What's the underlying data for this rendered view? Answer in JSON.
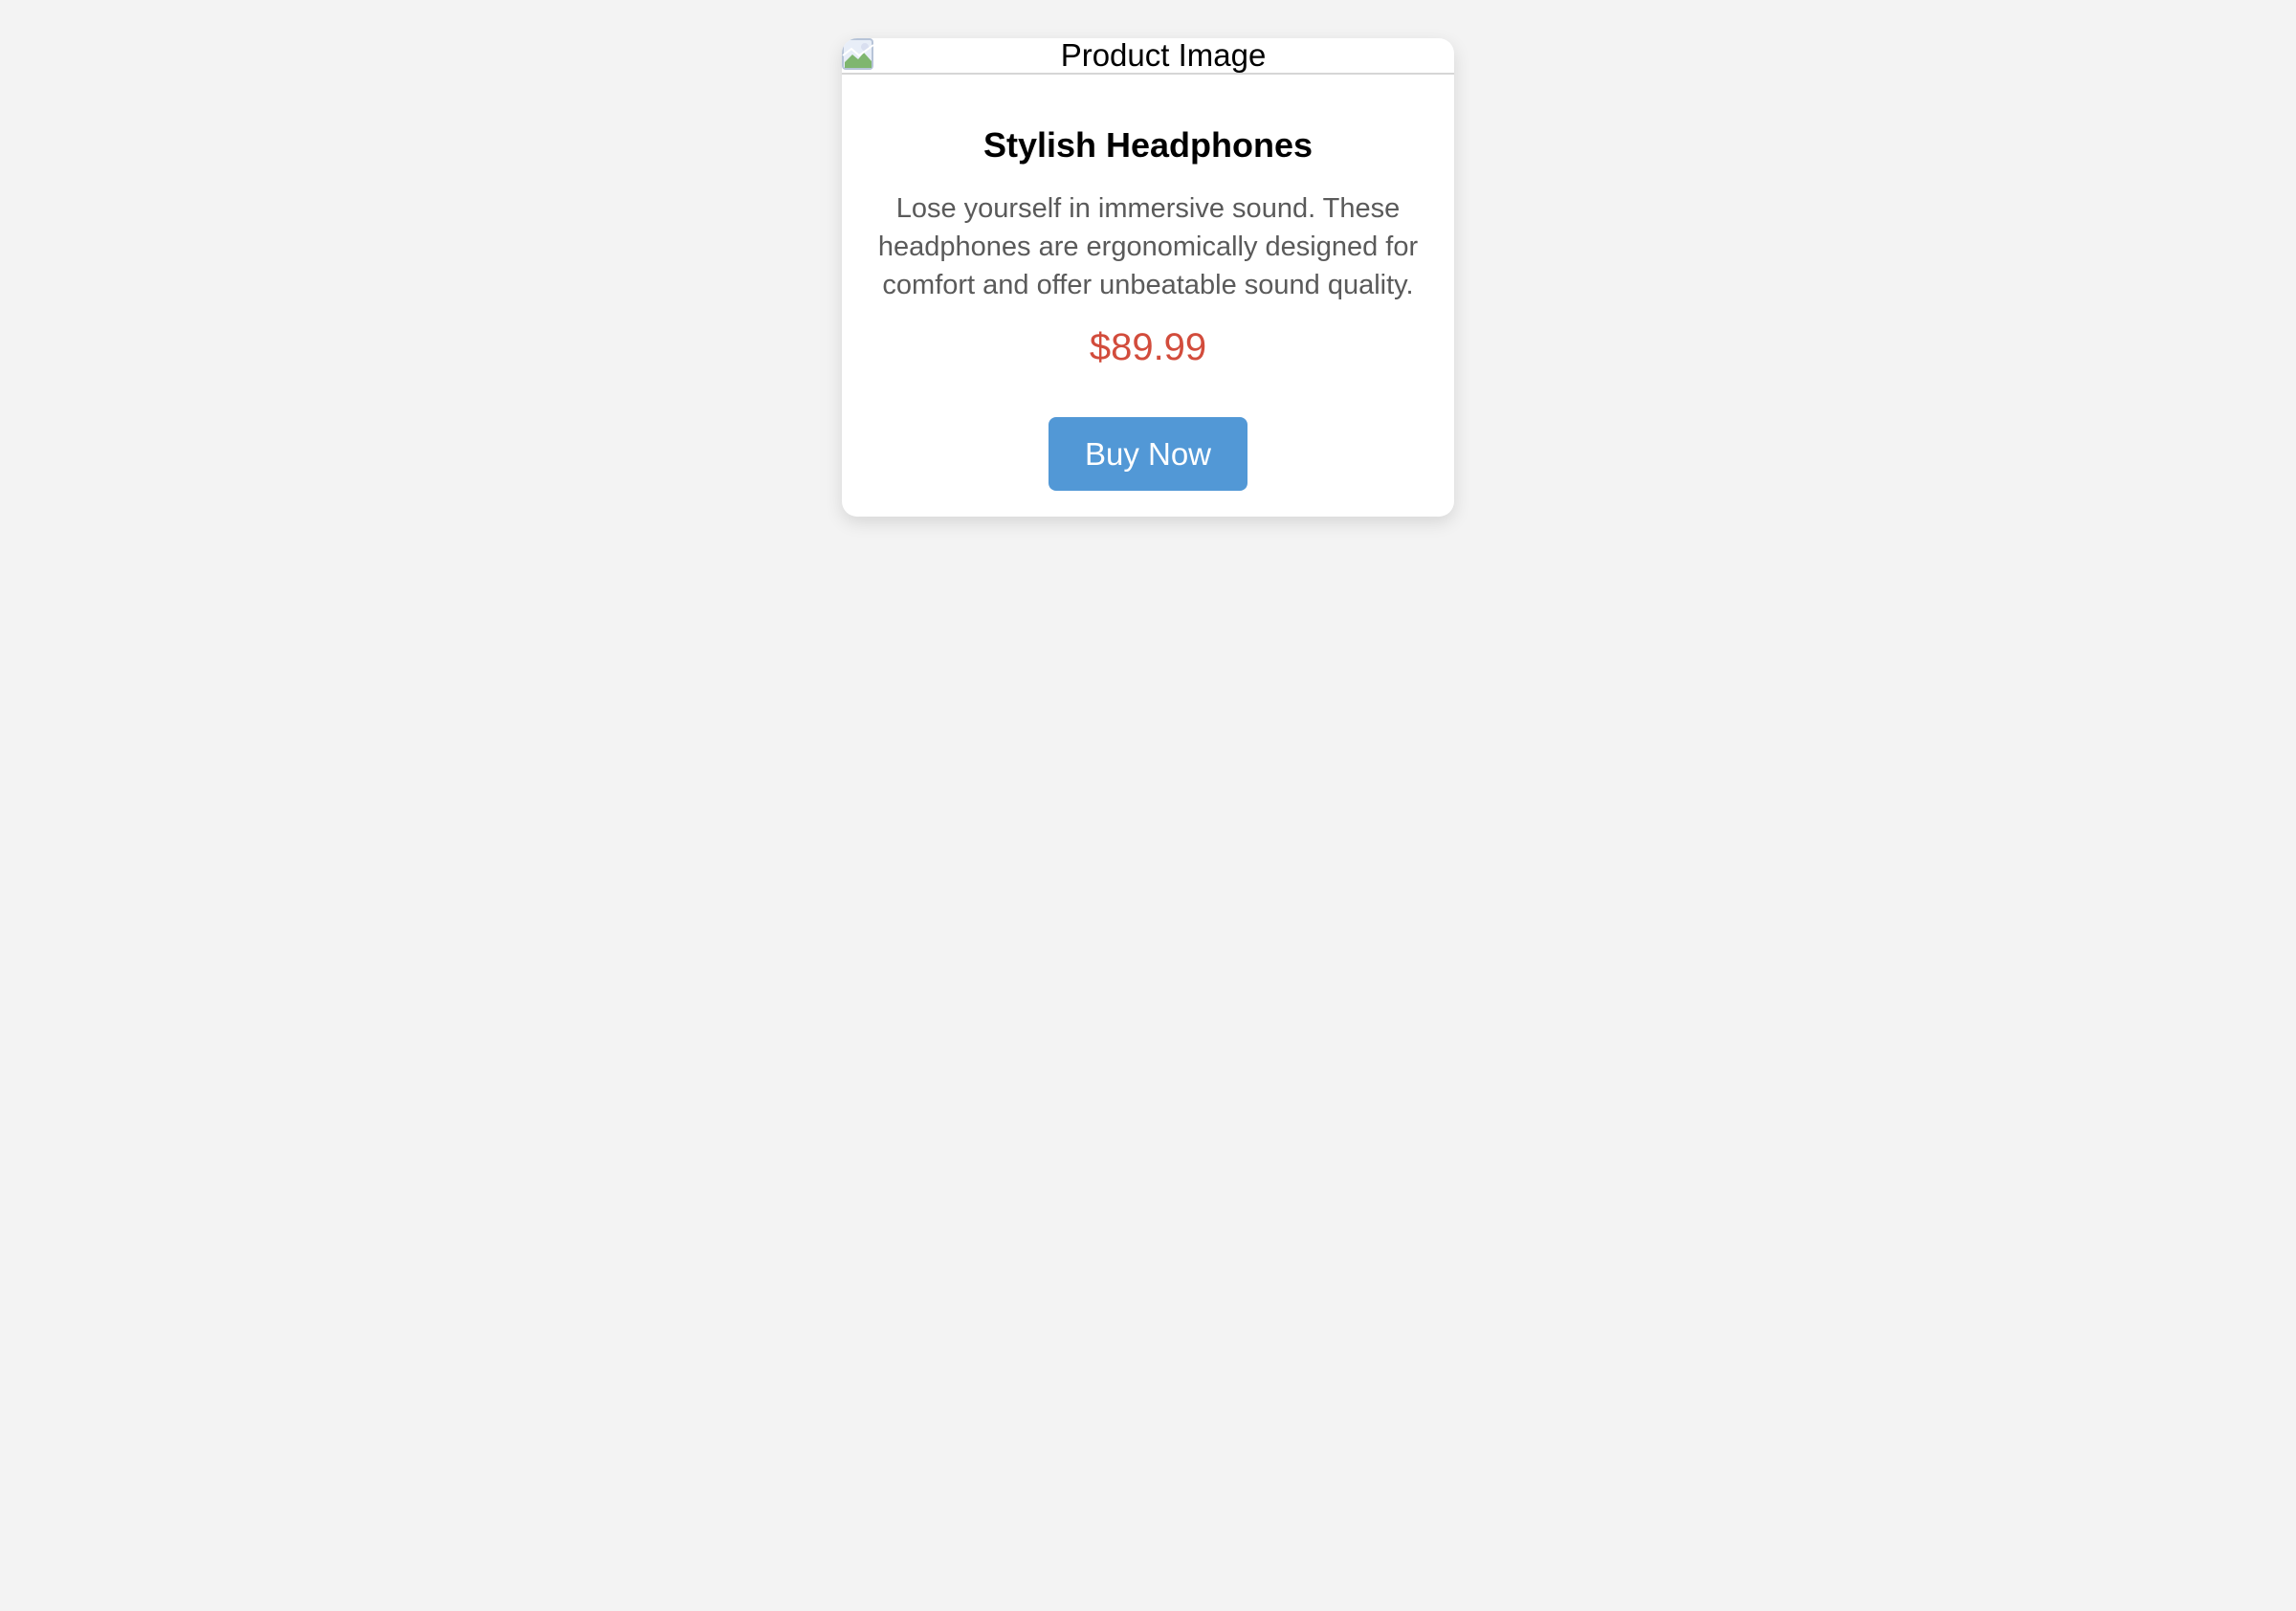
{
  "product_card": {
    "image_alt": "Product Image",
    "title": "Stylish Headphones",
    "description": "Lose yourself in immersive sound. These headphones are ergonomically designed for comfort and offer unbeatable sound quality.",
    "price": "$89.99",
    "buy_label": "Buy Now"
  },
  "colors": {
    "page_background": "#f3f3f3",
    "card_background": "#ffffff",
    "price": "#d24c3c",
    "button_background": "#5298d6",
    "button_text": "#ffffff",
    "description_text": "#5a5a5a"
  },
  "icons": {
    "image_placeholder": "broken-image-icon"
  }
}
